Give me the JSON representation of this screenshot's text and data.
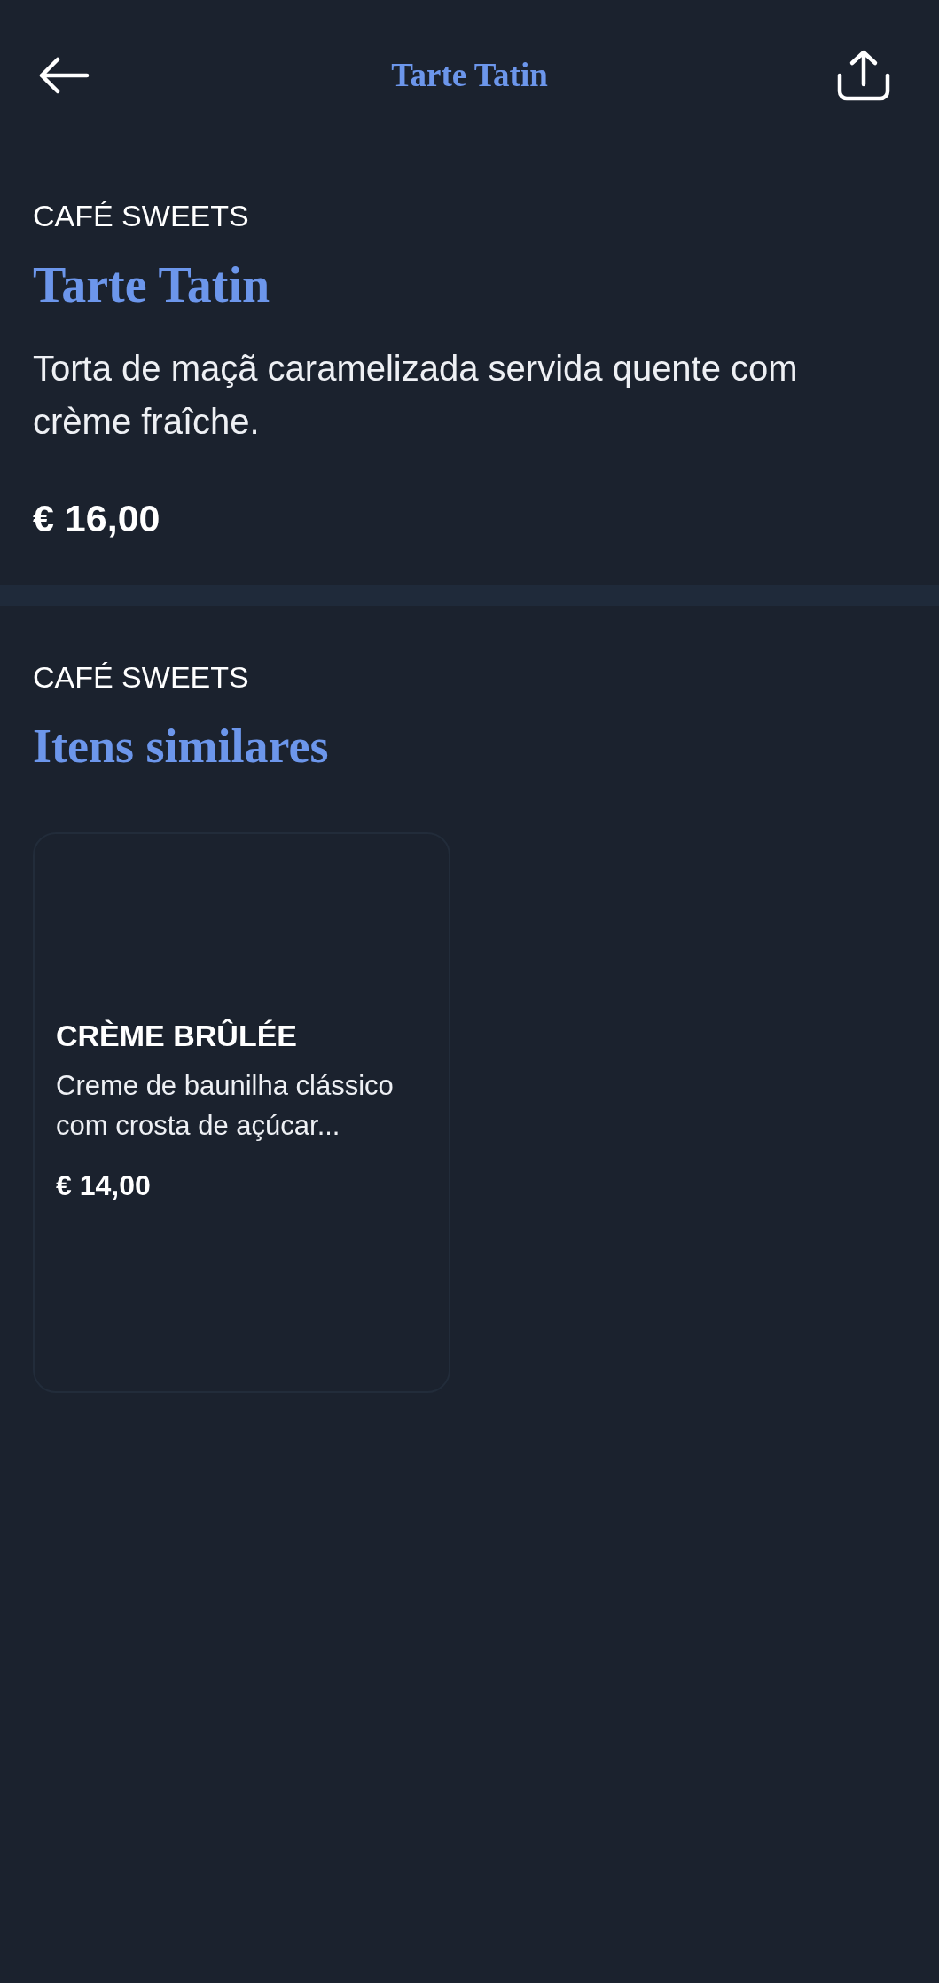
{
  "top_bar": {
    "title": "Tarte Tatin"
  },
  "item": {
    "category": "CAFÉ SWEETS",
    "name": "Tarte Tatin",
    "description": "Torta de maçã caramelizada servida quente com crème fraîche.",
    "price": "€ 16,00"
  },
  "similar": {
    "category": "CAFÉ SWEETS",
    "title": "Itens similares",
    "items": [
      {
        "name": "CRÈME BRÛLÉE",
        "description": "Creme de baunilha clássico com crosta de açúcar...",
        "price": "€ 14,00"
      }
    ]
  }
}
